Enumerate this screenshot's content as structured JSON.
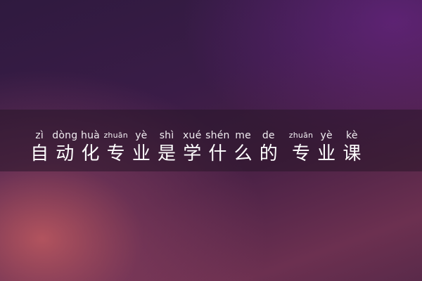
{
  "title": {
    "chars": [
      {
        "pinyin": "zì",
        "hanzi": "自"
      },
      {
        "pinyin": "dòng",
        "hanzi": "动"
      },
      {
        "pinyin": "huà",
        "hanzi": "化"
      },
      {
        "pinyin": "zhuān",
        "hanzi": "专"
      },
      {
        "pinyin": "yè",
        "hanzi": "业"
      },
      {
        "pinyin": "shì",
        "hanzi": "是"
      },
      {
        "pinyin": "xué",
        "hanzi": "学"
      },
      {
        "pinyin": "shén",
        "hanzi": "什"
      },
      {
        "pinyin": "me",
        "hanzi": "么"
      },
      {
        "pinyin": "de",
        "hanzi": "的"
      },
      {
        "pinyin": "zhuān",
        "hanzi": "专"
      },
      {
        "pinyin": "yè",
        "hanzi": "业"
      },
      {
        "pinyin": "kè",
        "hanzi": "课"
      }
    ]
  }
}
